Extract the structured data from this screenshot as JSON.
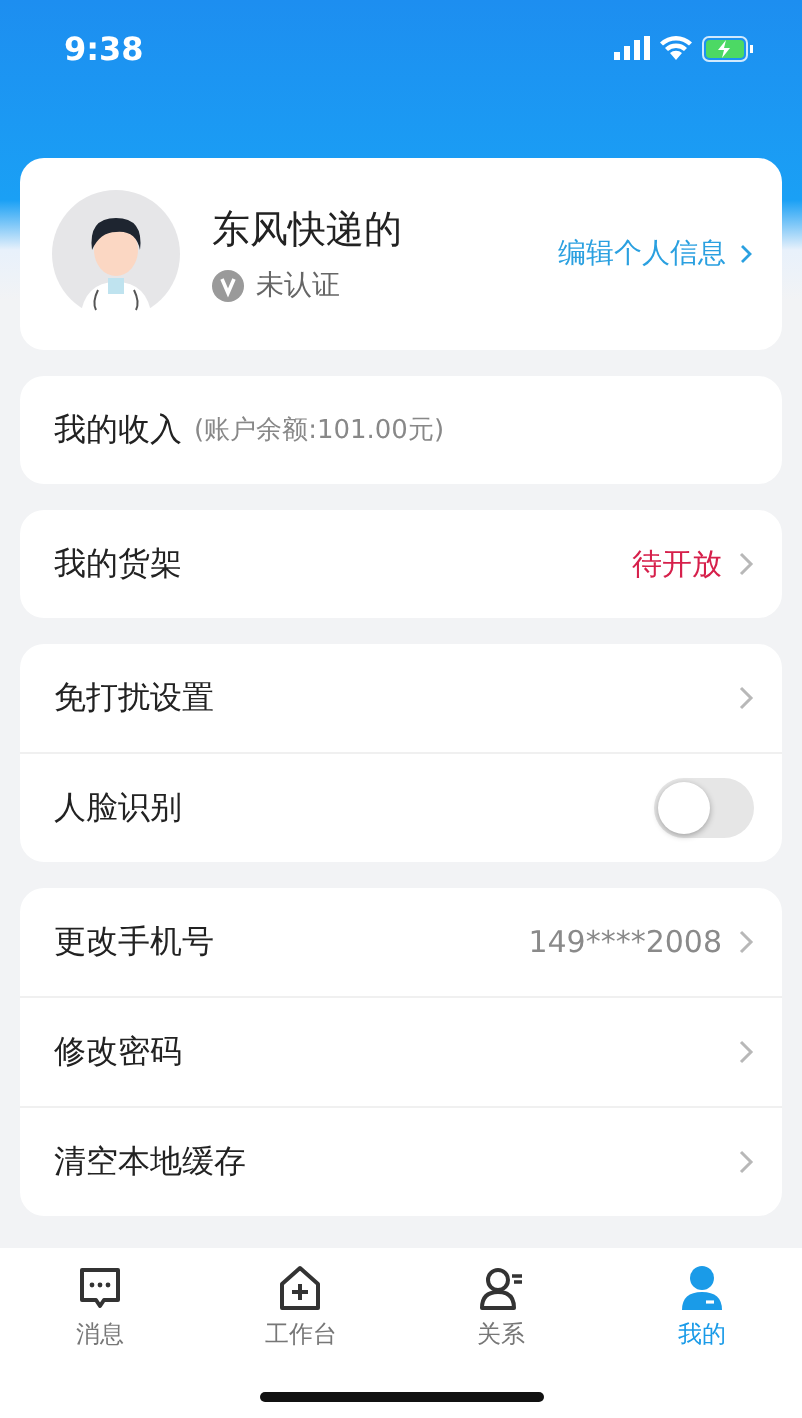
{
  "status_bar": {
    "time": "9:38"
  },
  "profile": {
    "name": "东风快递的",
    "verification": "未认证",
    "edit_link": "编辑个人信息"
  },
  "groups": [
    {
      "rows": [
        {
          "kind": "text",
          "label": "我的收入",
          "note": "(账户余额:101.00元)"
        }
      ]
    },
    {
      "rows": [
        {
          "kind": "link",
          "label": "我的货架",
          "value": "待开放",
          "color": "#d6204b"
        }
      ]
    },
    {
      "rows": [
        {
          "kind": "link",
          "label": "免打扰设置"
        },
        {
          "kind": "toggle",
          "label": "人脸识别",
          "on": false
        }
      ]
    },
    {
      "rows": [
        {
          "kind": "link",
          "label": "更改手机号",
          "value": "149****2008",
          "color": "#8a8a8a"
        },
        {
          "kind": "link",
          "label": "修改密码"
        },
        {
          "kind": "link",
          "label": "清空本地缓存"
        }
      ]
    }
  ],
  "tabs": [
    {
      "label": "消息",
      "selected": false
    },
    {
      "label": "工作台",
      "selected": false
    },
    {
      "label": "关系",
      "selected": false
    },
    {
      "label": "我的",
      "selected": true
    }
  ]
}
